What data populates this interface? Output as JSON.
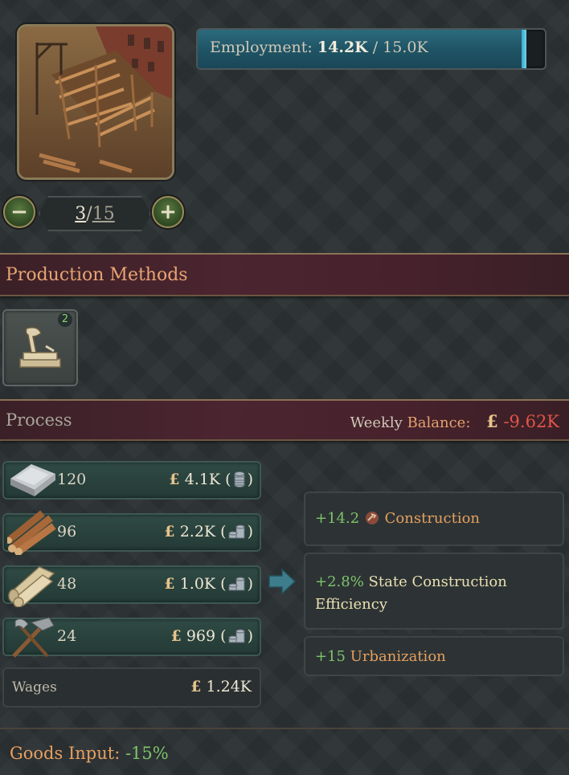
{
  "building": {
    "image_icon": "construction-sector-image",
    "employment_label": "Employment:",
    "employment_current": "14.2K",
    "employment_max": "/ 15.0K",
    "employment_fraction": 0.947,
    "level_current": "3",
    "level_separator": "/",
    "level_max": "15",
    "decrease_icon": "minus-icon",
    "increase_icon": "plus-icon"
  },
  "production_methods": {
    "title": "Production Methods",
    "method_icon": "construction-method-icon",
    "badge": "2"
  },
  "process": {
    "title": "Process",
    "weekly_label_pre": "Weekly ",
    "weekly_label_balance": "Balance:",
    "currency": "£",
    "weekly_amount": "-9.62K",
    "inputs": [
      {
        "icon": "iron-ingot-icon",
        "quantity": "120",
        "cost": "4.1K",
        "coin_icon": "coin-stack-icon"
      },
      {
        "icon": "wood-logs-icon",
        "quantity": "96",
        "cost": "2.2K",
        "coin_icon": "coin-pile-icon"
      },
      {
        "icon": "fabric-rolls-icon",
        "quantity": "48",
        "cost": "1.0K",
        "coin_icon": "coin-pile-icon"
      },
      {
        "icon": "tools-icon",
        "quantity": "24",
        "cost": "969",
        "coin_icon": "coin-pile-icon"
      }
    ],
    "paren_open": "(",
    "paren_close": ")",
    "wages_label": "Wages",
    "wages_amount": "1.24K",
    "arrow_icon": "right-arrow-icon",
    "outputs": [
      {
        "value": "+14.2",
        "icon": "construction-icon",
        "label": "Construction"
      },
      {
        "value": "+2.8%",
        "label": "State Construction Efficiency"
      },
      {
        "value": "+15",
        "label": "Urbanization"
      }
    ]
  },
  "footer": {
    "goods_input_label": "Goods Input",
    "colon": ":",
    "goods_input_value": "-15%"
  },
  "colors": {
    "positive": "#7ec46a",
    "negative": "#e25448",
    "accent_orange": "#e6a05e"
  }
}
